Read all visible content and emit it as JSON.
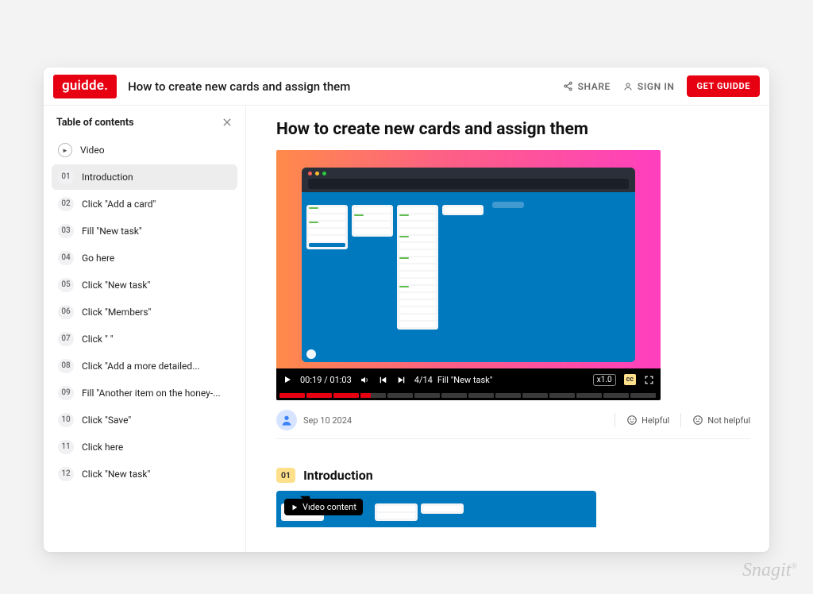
{
  "brand": {
    "logo": "guidde."
  },
  "header": {
    "title": "How to create new cards and assign them",
    "share_label": "SHARE",
    "signin_label": "SIGN IN",
    "cta_label": "GET GUIDDE"
  },
  "toc": {
    "heading": "Table of contents",
    "items": [
      {
        "num": "▶",
        "label": "Video",
        "kind": "play"
      },
      {
        "num": "01",
        "label": "Introduction",
        "active": true
      },
      {
        "num": "02",
        "label": "Click \"Add a card\""
      },
      {
        "num": "03",
        "label": "Fill \"New task\""
      },
      {
        "num": "04",
        "label": "Go here"
      },
      {
        "num": "05",
        "label": "Click \"New task\""
      },
      {
        "num": "06",
        "label": "Click \"Members\""
      },
      {
        "num": "07",
        "label": "Click \"                         \""
      },
      {
        "num": "08",
        "label": "Click \"Add a more detailed..."
      },
      {
        "num": "09",
        "label": "Fill \"Another item on the honey-..."
      },
      {
        "num": "10",
        "label": "Click \"Save\""
      },
      {
        "num": "11",
        "label": "Click here"
      },
      {
        "num": "12",
        "label": "Click \"New task\""
      }
    ]
  },
  "content": {
    "title": "How to create new cards and assign them"
  },
  "player": {
    "time": "00:19 / 01:03",
    "step_indicator": "4/14",
    "step_title": "Fill \"New task\"",
    "speed": "x1.0",
    "cc": "cc",
    "segments_total": 14,
    "segments_done": 3,
    "segment_current": 4
  },
  "meta": {
    "date": "Sep 10 2024",
    "helpful": "Helpful",
    "not_helpful": "Not helpful"
  },
  "section1": {
    "num": "01",
    "title": "Introduction",
    "pill": "Video content"
  },
  "watermark": "Snagit"
}
